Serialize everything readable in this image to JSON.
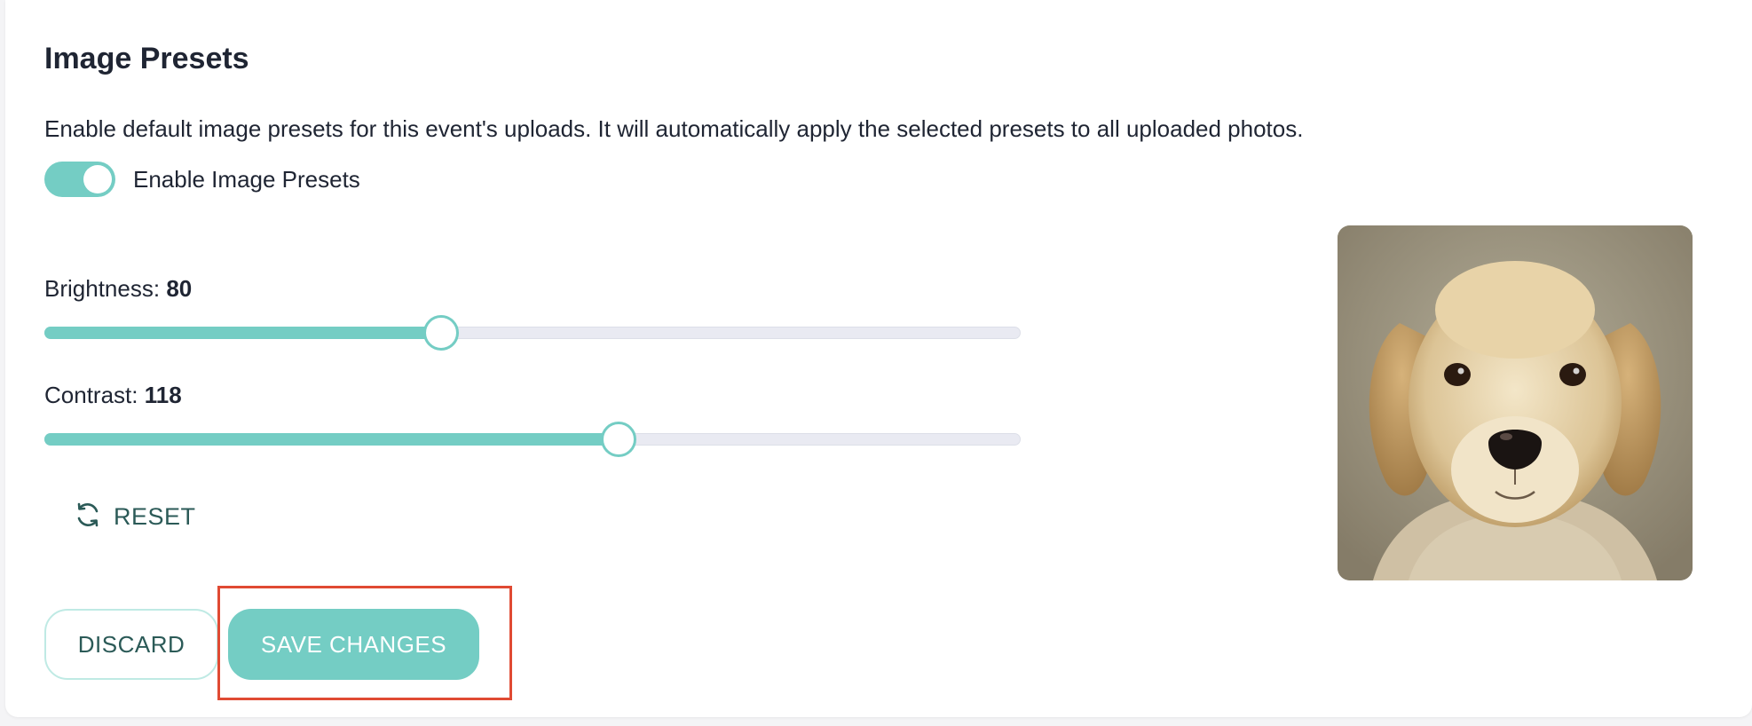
{
  "section": {
    "title": "Image Presets",
    "description": "Enable default image presets for this event's uploads. It will automatically apply the selected presets to all uploaded photos."
  },
  "toggle": {
    "label": "Enable Image Presets",
    "enabled": true
  },
  "sliders": {
    "brightness": {
      "label": "Brightness:",
      "value": "80",
      "fill_fraction": 0.405
    },
    "contrast": {
      "label": "Contrast:",
      "value": "118",
      "fill_fraction": 0.587
    }
  },
  "reset": {
    "label": "RESET",
    "icon": "refresh-icon"
  },
  "actions": {
    "discard_label": "DISCARD",
    "save_label": "SAVE CHANGES"
  },
  "preview": {
    "subject": "golden retriever puppy"
  },
  "colors": {
    "accent": "#74cdc4",
    "track": "#e9eaf2",
    "text": "#1f2533",
    "secondary_text": "#2b5a57",
    "highlight": "#e04a33"
  }
}
